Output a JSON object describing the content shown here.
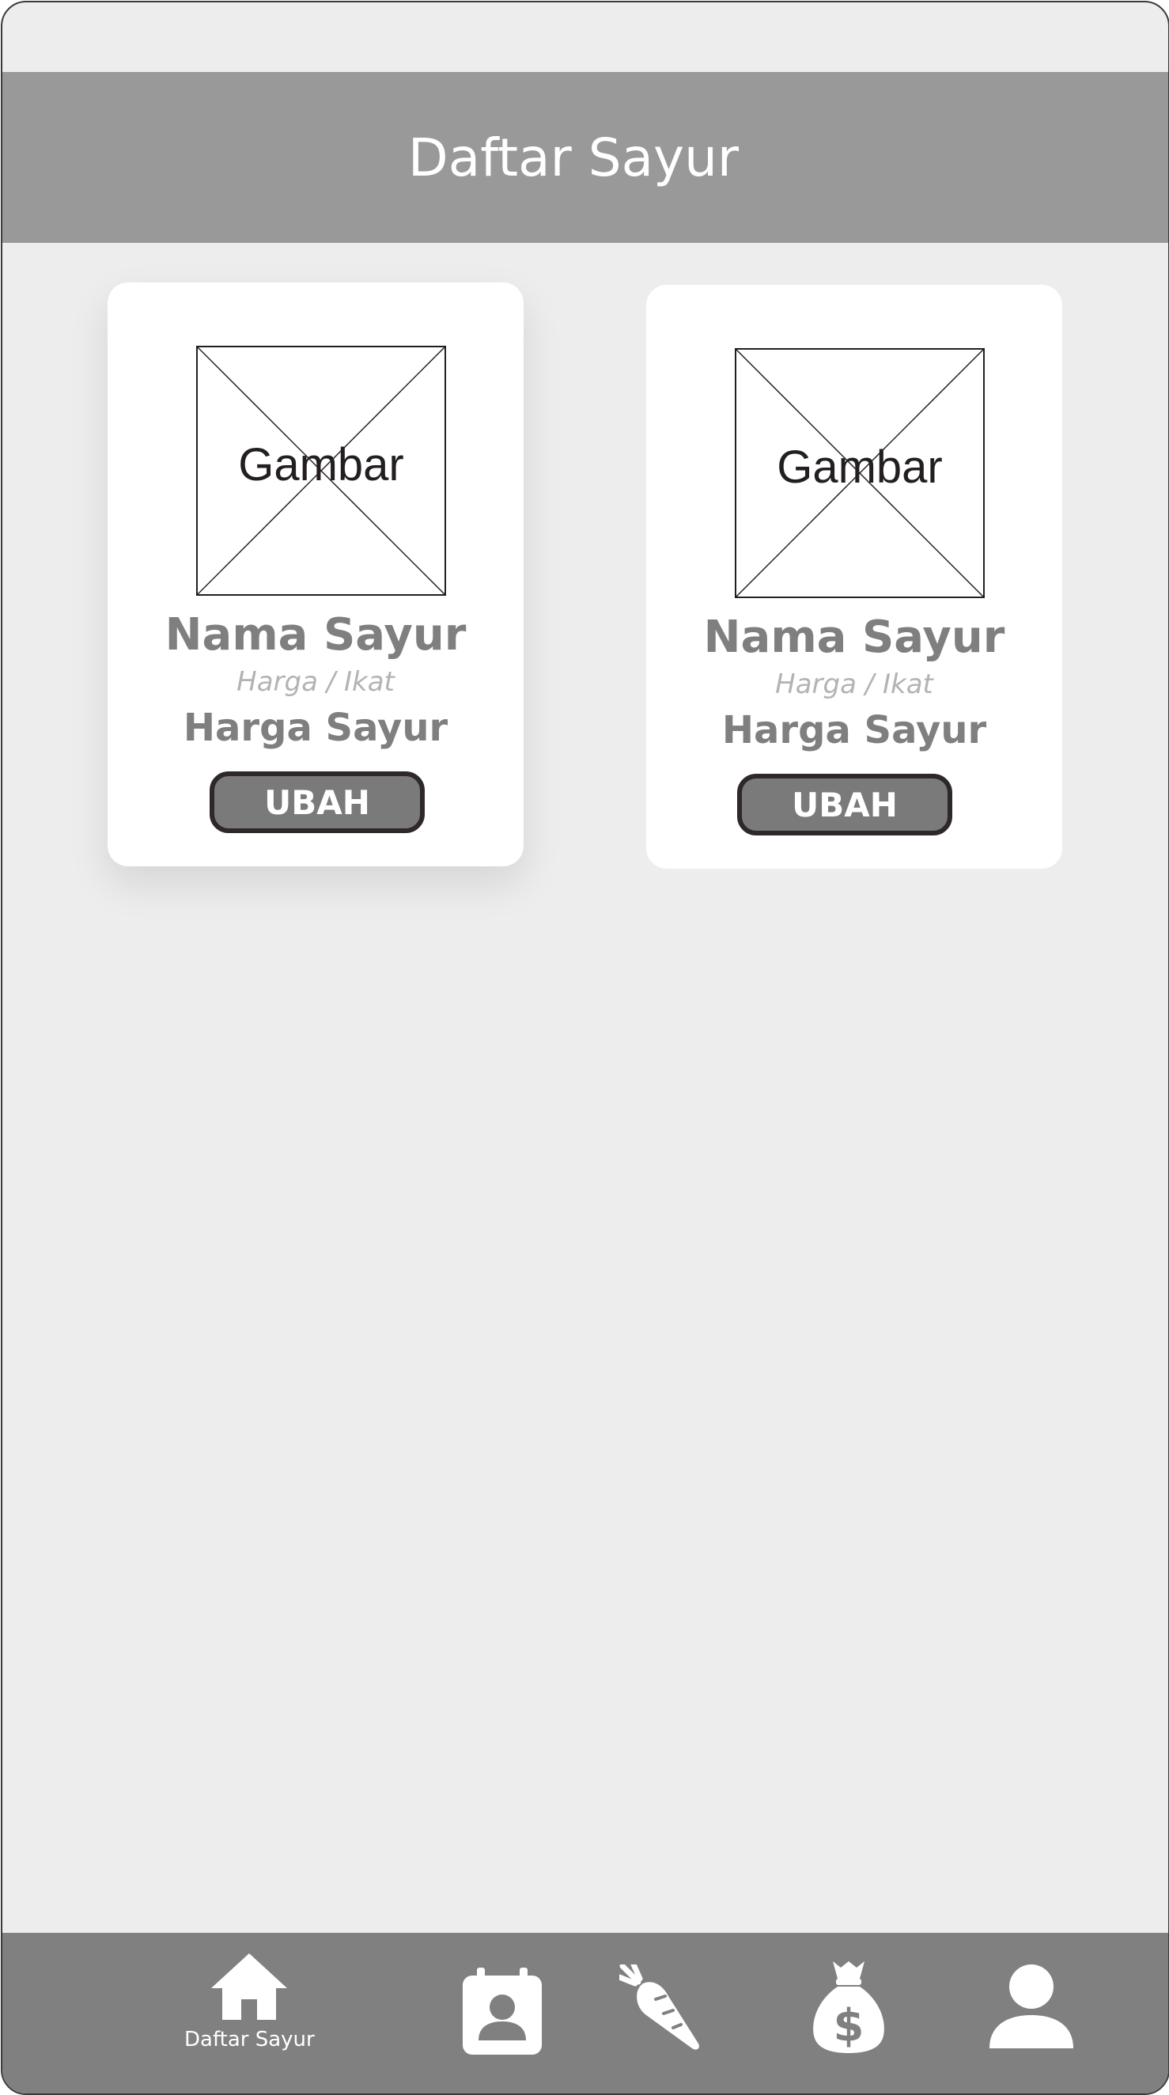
{
  "header": {
    "title": "Daftar Sayur"
  },
  "cards": [
    {
      "image_label": "Gambar",
      "name": "Nama Sayur",
      "unit": "Harga / Ikat",
      "price": "Harga Sayur",
      "button": "UBAH"
    },
    {
      "image_label": "Gambar",
      "name": "Nama Sayur",
      "unit": "Harga / Ikat",
      "price": "Harga Sayur",
      "button": "UBAH"
    }
  ],
  "bottom_nav": {
    "items": [
      {
        "icon": "home-icon",
        "label": "Daftar Sayur"
      },
      {
        "icon": "contact-calendar-icon"
      },
      {
        "icon": "carrot-icon"
      },
      {
        "icon": "money-bag-icon"
      },
      {
        "icon": "person-icon"
      }
    ]
  },
  "colors": {
    "app_bar": "#999999",
    "background": "#ededed",
    "bottom_nav": "#808080",
    "button_fill": "#7a7a7a",
    "text_gray": "#7f7f7f"
  }
}
